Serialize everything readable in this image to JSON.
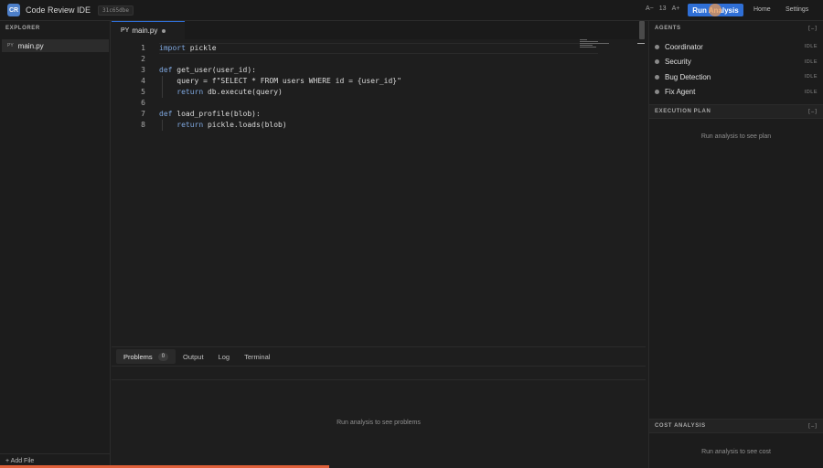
{
  "app": {
    "logo": "CR",
    "title": "Code Review IDE",
    "commit": "31c65dbe"
  },
  "toolbar": {
    "font_decrease": "A−",
    "font_size": "13",
    "font_increase": "A+",
    "run_label": "Run Analysis",
    "home_label": "Home",
    "settings_label": "Settings"
  },
  "explorer": {
    "title": "EXPLORER",
    "files": [
      {
        "type": "PY",
        "name": "main.py"
      }
    ],
    "add_file": "+ Add File"
  },
  "editor": {
    "tab": {
      "type": "PY",
      "name": "main.py",
      "modified": true
    },
    "lines": [
      {
        "n": "1",
        "tokens": [
          {
            "t": "import",
            "kw": true
          },
          {
            "t": " pickle"
          }
        ]
      },
      {
        "n": "2",
        "tokens": []
      },
      {
        "n": "3",
        "tokens": [
          {
            "t": "def",
            "kw": true
          },
          {
            "t": " get_user(user_id):"
          }
        ]
      },
      {
        "n": "4",
        "tokens": [
          {
            "t": "    query = f\"SELECT * FROM users WHERE id = {user_id}\""
          }
        ]
      },
      {
        "n": "5",
        "tokens": [
          {
            "t": "    "
          },
          {
            "t": "return",
            "kw": true
          },
          {
            "t": " db.execute(query)"
          }
        ]
      },
      {
        "n": "6",
        "tokens": []
      },
      {
        "n": "7",
        "tokens": [
          {
            "t": "def",
            "kw": true
          },
          {
            "t": " load_profile(blob):"
          }
        ]
      },
      {
        "n": "8",
        "tokens": [
          {
            "t": "    "
          },
          {
            "t": "return",
            "kw": true
          },
          {
            "t": " pickle.loads(blob)"
          }
        ]
      }
    ]
  },
  "bottom_panel": {
    "tabs": [
      {
        "label": "Problems",
        "badge": "0",
        "active": true
      },
      {
        "label": "Output"
      },
      {
        "label": "Log"
      },
      {
        "label": "Terminal"
      }
    ],
    "empty_text": "Run analysis to see problems"
  },
  "agents": {
    "title": "AGENTS",
    "collapse": "[−]",
    "items": [
      {
        "name": "Coordinator",
        "status": "IDLE"
      },
      {
        "name": "Security",
        "status": "IDLE"
      },
      {
        "name": "Bug Detection",
        "status": "IDLE"
      },
      {
        "name": "Fix Agent",
        "status": "IDLE"
      }
    ]
  },
  "execution_plan": {
    "title": "EXECUTION PLAN",
    "collapse": "[−]",
    "empty_text": "Run analysis to see plan"
  },
  "cost_analysis": {
    "title": "COST ANALYSIS",
    "collapse": "[−]",
    "empty_text": "Run analysis to see cost"
  },
  "progress": {
    "fraction": 0.4
  },
  "colors": {
    "accent": "#2f6fd6",
    "progress": "#e0603a",
    "keyword": "#7fa8e0"
  }
}
